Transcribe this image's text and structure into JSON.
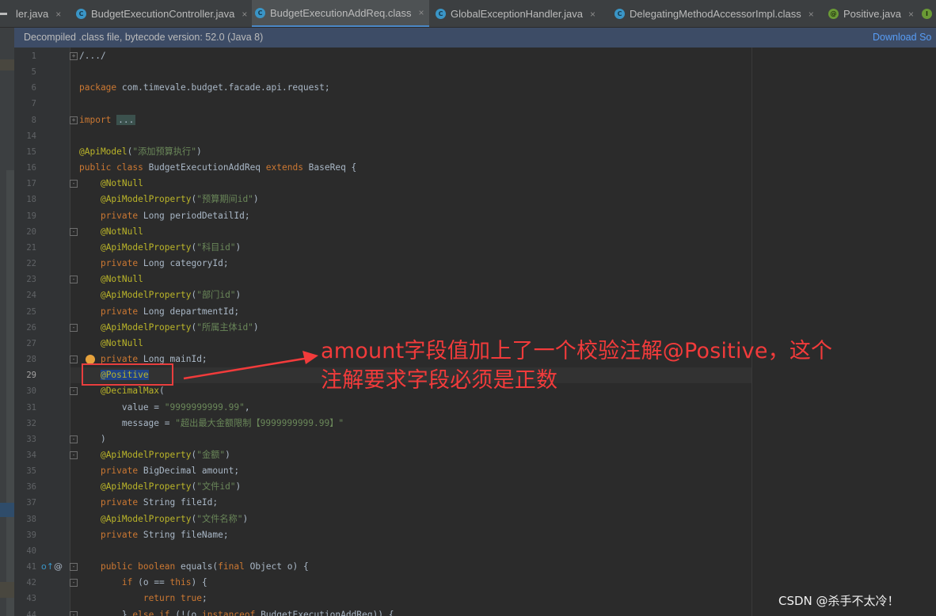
{
  "tabs": [
    {
      "label": "ler.java",
      "icon": "none",
      "active": false
    },
    {
      "label": "BudgetExecutionController.java",
      "icon": "C",
      "active": false
    },
    {
      "label": "BudgetExecutionAddReq.class",
      "icon": "C",
      "active": true
    },
    {
      "label": "GlobalExceptionHandler.java",
      "icon": "C",
      "active": false
    },
    {
      "label": "DelegatingMethodAccessorImpl.class",
      "icon": "C",
      "active": false
    },
    {
      "label": "Positive.java",
      "icon": "@",
      "active": false
    }
  ],
  "banner": {
    "text": "Decompiled .class file, bytecode version: 52.0 (Java 8)",
    "download_label": "Download So"
  },
  "code_lines": [
    {
      "n": "1",
      "text": "/.../"
    },
    {
      "n": "5",
      "text": ""
    },
    {
      "n": "6",
      "text": "package com.timevale.budget.facade.api.request;"
    },
    {
      "n": "7",
      "text": ""
    },
    {
      "n": "8",
      "text": "import ..."
    },
    {
      "n": "14",
      "text": ""
    },
    {
      "n": "15",
      "text": "@ApiModel(\"添加预算执行\")"
    },
    {
      "n": "16",
      "text": "public class BudgetExecutionAddReq extends BaseReq {"
    },
    {
      "n": "17",
      "text": "    @NotNull"
    },
    {
      "n": "18",
      "text": "    @ApiModelProperty(\"预算期间id\")"
    },
    {
      "n": "19",
      "text": "    private Long periodDetailId;"
    },
    {
      "n": "20",
      "text": "    @NotNull"
    },
    {
      "n": "21",
      "text": "    @ApiModelProperty(\"科目id\")"
    },
    {
      "n": "22",
      "text": "    private Long categoryId;"
    },
    {
      "n": "23",
      "text": "    @NotNull"
    },
    {
      "n": "24",
      "text": "    @ApiModelProperty(\"部门id\")"
    },
    {
      "n": "25",
      "text": "    private Long departmentId;"
    },
    {
      "n": "26",
      "text": "    @ApiModelProperty(\"所属主体id\")"
    },
    {
      "n": "27",
      "text": "    @NotNull"
    },
    {
      "n": "28",
      "text": "    private Long mainId;"
    },
    {
      "n": "29",
      "text": "    @Positive"
    },
    {
      "n": "30",
      "text": "    @DecimalMax("
    },
    {
      "n": "31",
      "text": "        value = \"9999999999.99\","
    },
    {
      "n": "32",
      "text": "        message = \"超出最大金额限制【9999999999.99】\""
    },
    {
      "n": "33",
      "text": "    )"
    },
    {
      "n": "34",
      "text": "    @ApiModelProperty(\"金额\")"
    },
    {
      "n": "35",
      "text": "    private BigDecimal amount;"
    },
    {
      "n": "36",
      "text": "    @ApiModelProperty(\"文件id\")"
    },
    {
      "n": "37",
      "text": "    private String fileId;"
    },
    {
      "n": "38",
      "text": "    @ApiModelProperty(\"文件名称\")"
    },
    {
      "n": "39",
      "text": "    private String fileName;"
    },
    {
      "n": "40",
      "text": ""
    },
    {
      "n": "41",
      "text": "    public boolean equals(final Object o) {"
    },
    {
      "n": "42",
      "text": "        if (o == this) {"
    },
    {
      "n": "43",
      "text": "            return true;"
    },
    {
      "n": "44",
      "text": "        } else if (!(o instanceof BudgetExecutionAddReq)) {"
    }
  ],
  "current_line": "29",
  "annotation": {
    "line1": "amount字段值加上了一个校验注解@Positive，这个",
    "line2": "注解要求字段必须是正数",
    "color": "#f23b3b"
  },
  "watermark": "CSDN @杀手不太冷！",
  "colors": {
    "editor_bg": "#2b2b2b",
    "keyword": "#cc7832",
    "annotation": "#bbb529",
    "string": "#6a8759",
    "text": "#a9b7c6"
  }
}
